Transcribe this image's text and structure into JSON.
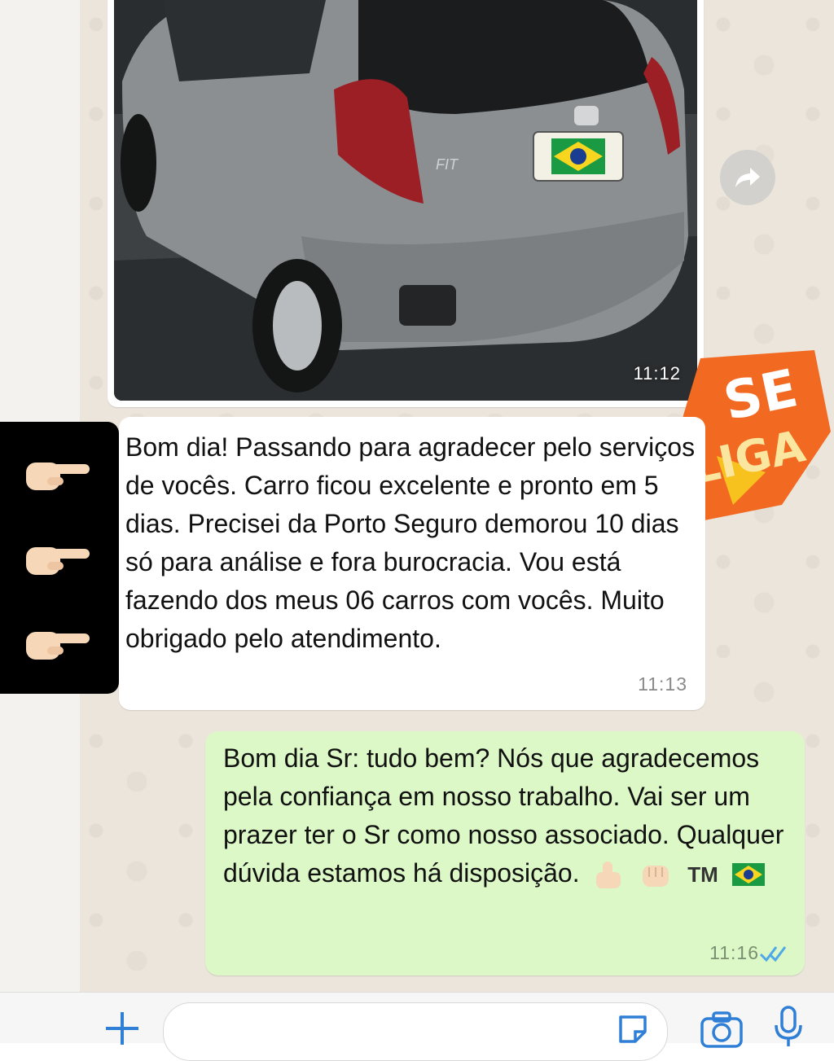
{
  "image_message": {
    "time": "11:12",
    "photo_alt": "Honda Fit prata, traseira",
    "plate_flag": "Brasil",
    "badge_text": "FIT"
  },
  "incoming_message": {
    "text": "Bom dia! Passando para agradecer pelo serviços de vocês. Carro ficou excelente e pronto em 5 dias. Precisei da Porto Seguro demorou 10 dias só para análise e fora burocracia. Vou está fazendo dos meus 06 carros com vocês. Muito obrigado pelo atendimento.",
    "time": "11:13"
  },
  "outgoing_message": {
    "text": "Bom dia Sr: tudo bem? Nós que agradecemos pela confiança em nosso trabalho. Vai ser um prazer ter o Sr como nosso associado. Qualquer dúvida estamos há disposição.",
    "tm": "TM",
    "time": "11:16"
  },
  "sticker": {
    "line1": "SE",
    "line2": "LIGA"
  },
  "colors": {
    "chat_background": "#ece5dc",
    "incoming_bubble": "#ffffff",
    "outgoing_bubble": "#dcf8c6",
    "read_ticks": "#4fa8e8",
    "accent": "#2f7fd6",
    "sticker_orange": "#f26a22"
  },
  "icons": [
    "pointing-right-hand-icon",
    "forward-icon",
    "thumbs-up-icon",
    "fist-bump-icon",
    "brazil-flag-icon",
    "double-check-icon",
    "plus-icon",
    "sticker-icon",
    "camera-icon",
    "microphone-icon"
  ]
}
